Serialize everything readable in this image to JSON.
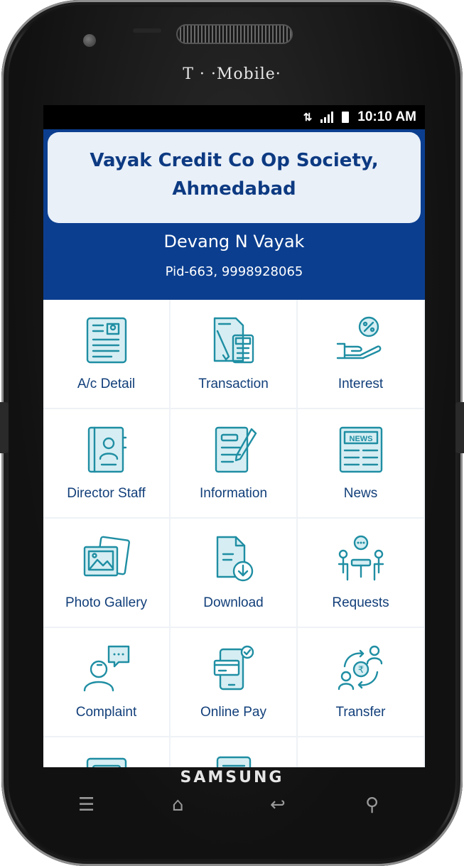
{
  "device": {
    "carrier": "T · ·Mobile·",
    "brand": "SAMSUNG"
  },
  "status_bar": {
    "time": "10:10 AM",
    "network_icon": "4g-icon",
    "signal_icon": "signal-bars-icon",
    "battery_icon": "battery-icon"
  },
  "header": {
    "org_name": "Vayak Credit Co Op Society, Ahmedabad",
    "user_name": "Devang N Vayak",
    "user_meta": "Pid-663, 9998928065"
  },
  "menu": [
    {
      "label": "A/c Detail",
      "icon": "account-detail-icon"
    },
    {
      "label": "Transaction",
      "icon": "transaction-icon"
    },
    {
      "label": "Interest",
      "icon": "interest-icon"
    },
    {
      "label": "Director Staff",
      "icon": "director-staff-icon"
    },
    {
      "label": "Information",
      "icon": "information-icon"
    },
    {
      "label": "News",
      "icon": "news-icon"
    },
    {
      "label": "Photo Gallery",
      "icon": "photo-gallery-icon"
    },
    {
      "label": "Download",
      "icon": "download-icon"
    },
    {
      "label": "Requests",
      "icon": "requests-icon"
    },
    {
      "label": "Complaint",
      "icon": "complaint-icon"
    },
    {
      "label": "Online Pay",
      "icon": "online-pay-icon"
    },
    {
      "label": "Transfer",
      "icon": "transfer-icon"
    },
    {
      "label": "",
      "icon": "calendar-icon"
    },
    {
      "label": "",
      "icon": "document-icon"
    }
  ],
  "news_badge": "NEWS",
  "hardware_keys": [
    "menu-key-icon",
    "home-key-icon",
    "back-key-icon",
    "search-key-icon"
  ],
  "colors": {
    "header_bg": "#0b3e8f",
    "title_card_bg": "#e9f0f8",
    "title_text": "#0d3a82",
    "icon_stroke": "#1f8ea3",
    "label_text": "#123f7a"
  }
}
